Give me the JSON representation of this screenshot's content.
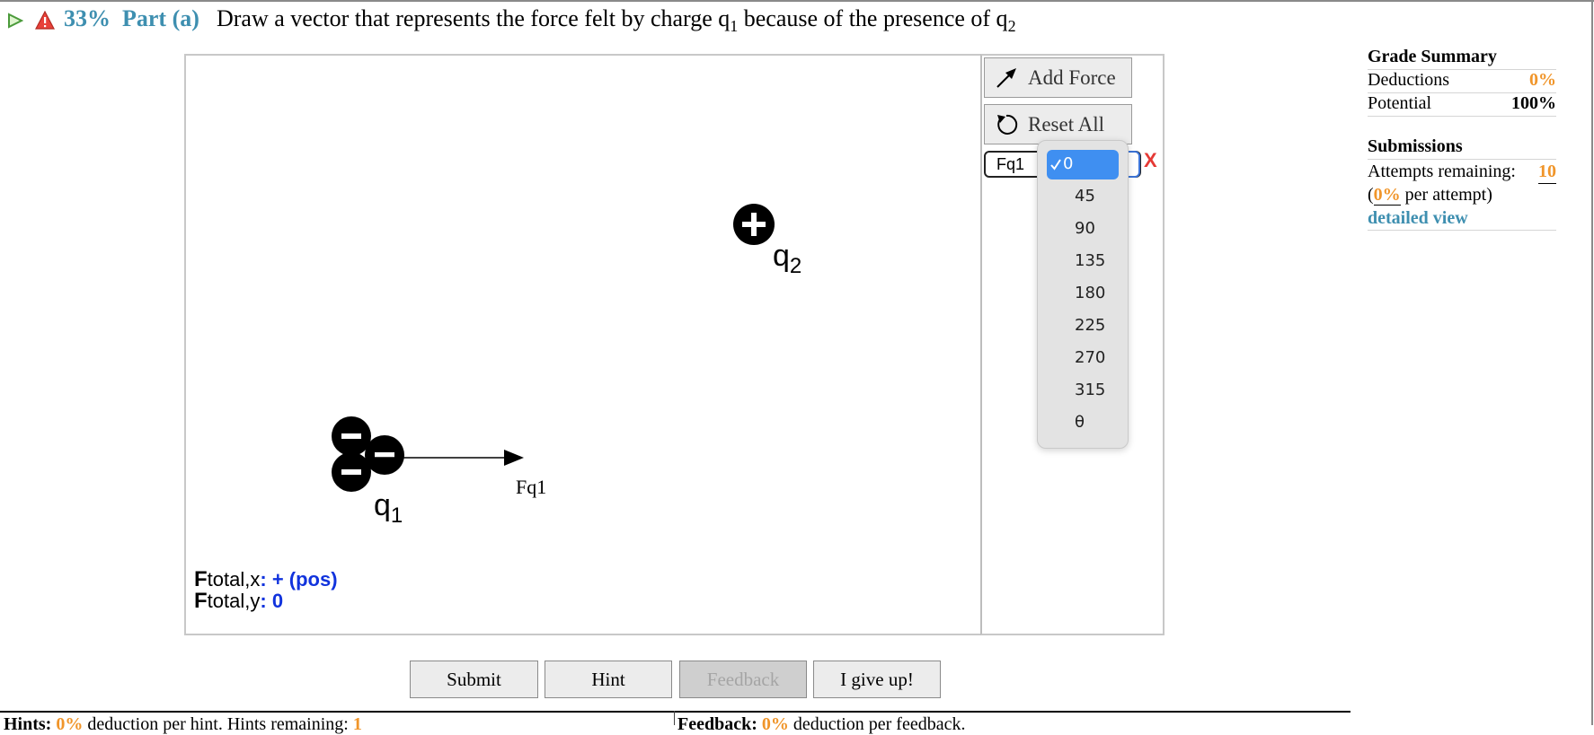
{
  "header": {
    "score": "33%",
    "part": "Part (a)",
    "prompt_prefix": "Draw a vector that represents the force felt by charge q",
    "prompt_sub1": "1",
    "prompt_mid": " because of the presence of q",
    "prompt_sub2": "2"
  },
  "toolbar": {
    "add_force": "Add Force",
    "reset_all": "Reset All",
    "force_name": "Fq1",
    "remove": "X"
  },
  "angle_dropdown": {
    "selected": "0",
    "options": [
      "0",
      "45",
      "90",
      "135",
      "180",
      "225",
      "270",
      "315",
      "θ"
    ]
  },
  "canvas": {
    "q2_label": "q",
    "q2_sub": "2",
    "q1_label": "q",
    "q1_sub": "1",
    "vector_label": "Fq1",
    "ftotal_x_label": "F",
    "ftotal_x_sub": "total,x",
    "ftotal_x_value": ": + (pos)",
    "ftotal_y_label": "F",
    "ftotal_y_sub": "total,y",
    "ftotal_y_value": ": 0"
  },
  "grade_summary": {
    "title": "Grade Summary",
    "deductions_label": "Deductions",
    "deductions_value": "0%",
    "potential_label": "Potential",
    "potential_value": "100%"
  },
  "submissions": {
    "title": "Submissions",
    "attempts_label": "Attempts remaining:",
    "attempts_value": "10",
    "per_attempt_open": "(",
    "per_attempt_value": "0%",
    "per_attempt_text": " per attempt)",
    "detailed_view": "detailed view"
  },
  "buttons": {
    "submit": "Submit",
    "hint": "Hint",
    "feedback": "Feedback",
    "give_up": "I give up!"
  },
  "footer": {
    "hints_label": "Hints:",
    "hints_value": "0%",
    "hints_text": " deduction per hint. Hints remaining:",
    "hints_remaining": "1",
    "feedback_label": "Feedback:",
    "feedback_value": "0%",
    "feedback_text": " deduction per feedback."
  },
  "colors": {
    "header_blue": "#3e8fb0",
    "accent_orange": "#f0952a",
    "value_blue": "#1133dd",
    "remove_red": "#e53935",
    "dropdown_highlight": "#3f8ff1"
  }
}
